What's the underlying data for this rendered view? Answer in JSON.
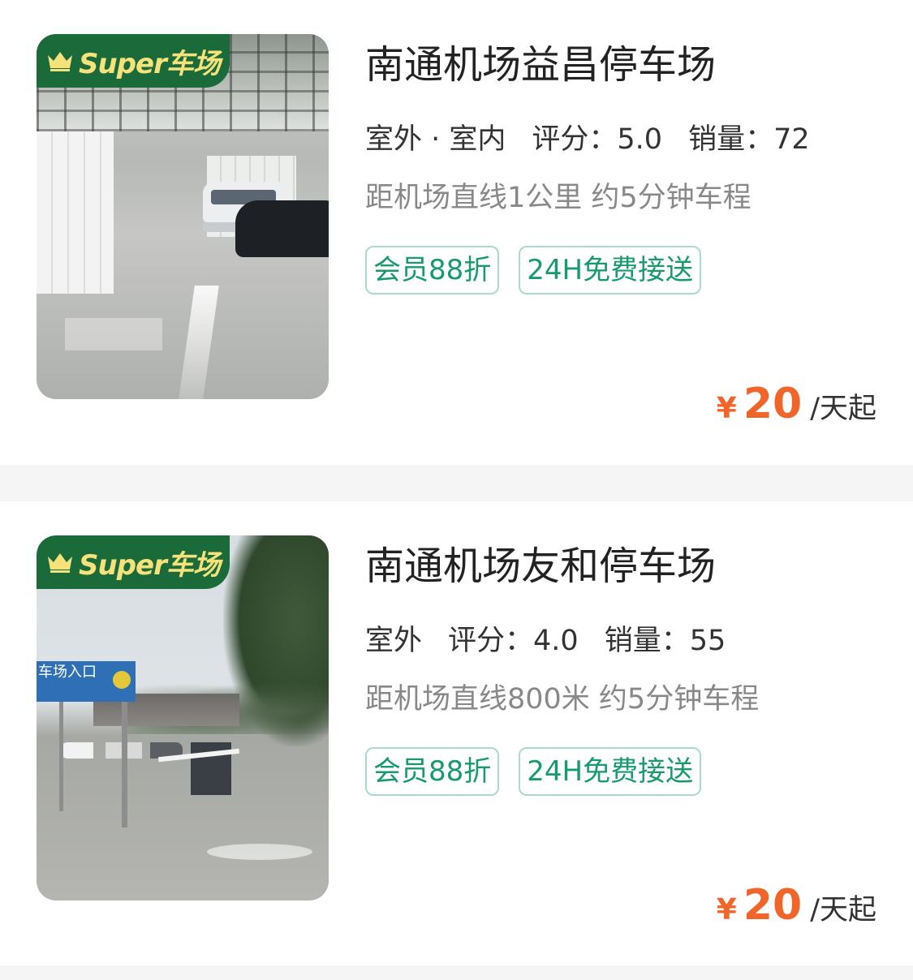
{
  "listings": [
    {
      "badge": "Super车场",
      "badge_icon": "crown-icon",
      "name": "南通机场益昌停车场",
      "environment": "室外 · 室内",
      "rating": "评分：5.0",
      "sales": "销量：72",
      "distance": "距机场直线1公里 约5分钟车程",
      "tags": [
        "会员88折",
        "24H免费接送"
      ],
      "price_symbol": "¥",
      "price": "20",
      "price_unit": "/天起"
    },
    {
      "badge": "Super车场",
      "badge_icon": "crown-icon",
      "name": "南通机场友和停车场",
      "environment": "室外",
      "rating": "评分：4.0",
      "sales": "销量：55",
      "distance": "距机场直线800米 约5分钟车程",
      "tags": [
        "会员88折",
        "24H免费接送"
      ],
      "price_symbol": "¥",
      "price": "20",
      "price_unit": "/天起",
      "photo_sign": "车场入口"
    }
  ],
  "colors": {
    "badge_bg": "#1b6b3a",
    "badge_text": "#f6e27a",
    "tag_text": "#179a6c",
    "tag_border": "#a8dbc9",
    "price": "#f0662a",
    "env_underline": "#34c48e"
  }
}
